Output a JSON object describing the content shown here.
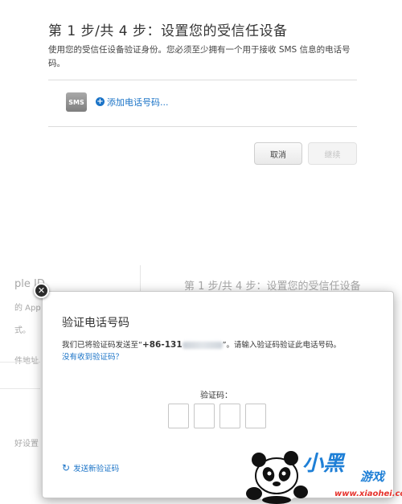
{
  "step_panel": {
    "title": "第 1 步/共 4 步：设置您的受信任设备",
    "description": "使用您的受信任设备验证身份。您必须至少拥有一个用于接收 SMS 信息的电话号码。",
    "sms_badge": "SMS",
    "add_phone_link": "添加电话号码...",
    "cancel_button": "取消",
    "continue_button": "继续"
  },
  "background_page": {
    "left_fragments": [
      "ple ID",
      "的 App",
      "式。",
      "件地址",
      "好设置"
    ],
    "title": "第 1 步/共 4 步：设置您的受信任设备"
  },
  "verify_dialog": {
    "close_symbol": "✕",
    "title": "验证电话号码",
    "desc_before": "我们已将验证码发送至“",
    "phone_prefix": "+86-131",
    "desc_after": "”。请输入验证码验证此电话号码。",
    "no_code_link": "没有收到验证码？",
    "code_label": "验证码：",
    "resend_link": "发送新验证码"
  },
  "watermark": {
    "brand": "小黑",
    "game": "游戏",
    "url": "www.xiaohei.com"
  },
  "icons": {
    "add": "plus-circle-icon",
    "close": "close-icon",
    "resend": "refresh-icon"
  },
  "colors": {
    "link": "#1a73c7",
    "primary_button": "#3d8fde"
  }
}
